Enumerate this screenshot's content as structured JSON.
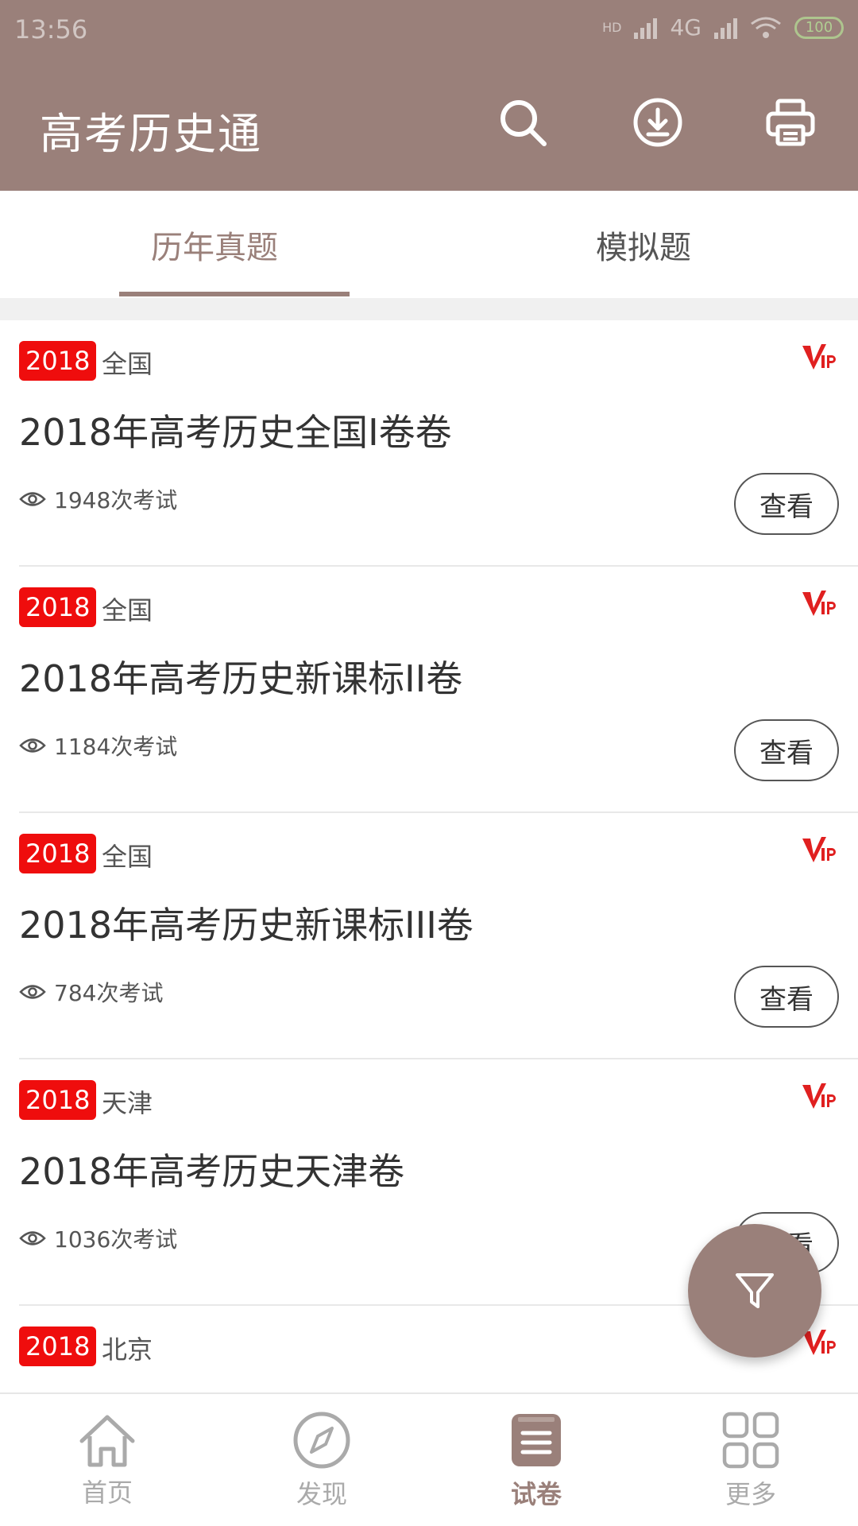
{
  "status": {
    "time": "13:56",
    "network": "4G",
    "hd": "HD",
    "battery": "100"
  },
  "header": {
    "title": "高考历史通",
    "icons": [
      "search-icon",
      "download-icon",
      "print-icon"
    ]
  },
  "tabs": [
    {
      "label": "历年真题",
      "active": true
    },
    {
      "label": "模拟题",
      "active": false
    }
  ],
  "papers": [
    {
      "year": "2018",
      "region": "全国",
      "title": "2018年高考历史全国I卷卷",
      "views": "1948次考试",
      "action": "查看"
    },
    {
      "year": "2018",
      "region": "全国",
      "title": "2018年高考历史新课标II卷",
      "views": "1184次考试",
      "action": "查看"
    },
    {
      "year": "2018",
      "region": "全国",
      "title": "2018年高考历史新课标III卷",
      "views": "784次考试",
      "action": "查看"
    },
    {
      "year": "2018",
      "region": "天津",
      "title": "2018年高考历史天津卷",
      "views": "1036次考试",
      "action": "查看"
    },
    {
      "year": "2018",
      "region": "北京"
    }
  ],
  "fab": {
    "icon": "filter-icon"
  },
  "bottom_nav": [
    {
      "label": "首页",
      "icon": "home-icon",
      "active": false
    },
    {
      "label": "发现",
      "icon": "compass-icon",
      "active": false
    },
    {
      "label": "试卷",
      "icon": "paper-icon",
      "active": true
    },
    {
      "label": "更多",
      "icon": "grid-icon",
      "active": false
    }
  ],
  "colors": {
    "primary": "#9a807a",
    "badge": "#ef0d0d",
    "vip": "#e02020"
  }
}
